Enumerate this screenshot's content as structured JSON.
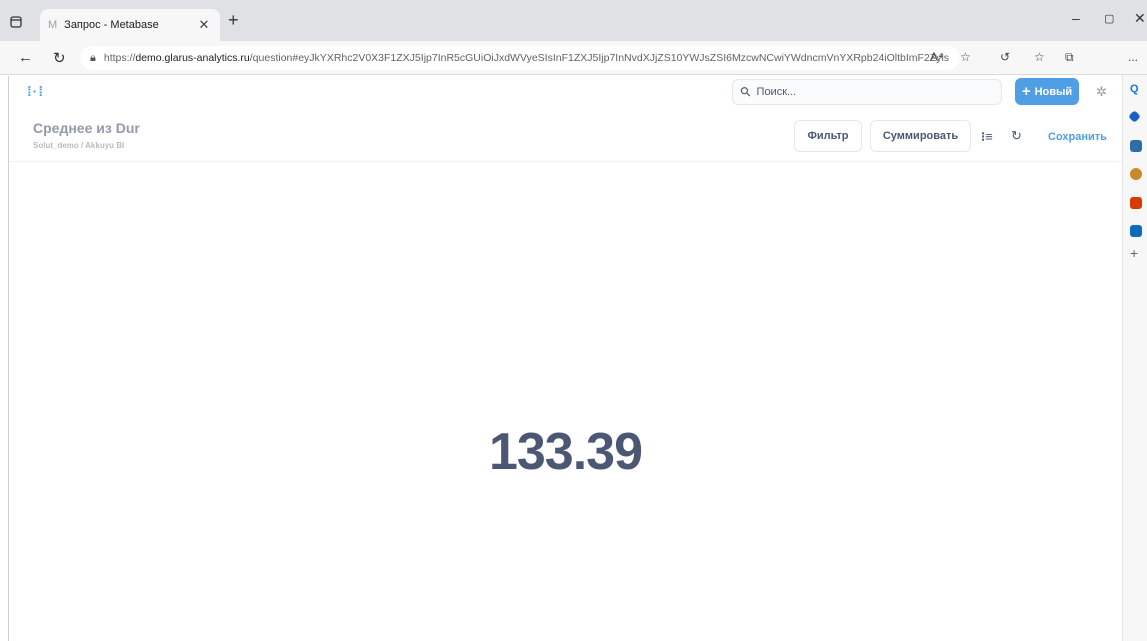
{
  "browser": {
    "tab_title": "Запрос - Metabase",
    "tab_favicon": "M",
    "new_tab_label": "+",
    "url_prefix": "https://",
    "url_host": "demo.glarus-analytics.ru",
    "url_path": "/question#eyJkYXRhc2V0X3F1ZXJ5Ijp7InR5cGUiOiJxdWVyeSIsInF1ZXJ5Ijp7InNvdXJjZS10YWJsZSI6MzcwNCwiYWdncmVnYXRpb24iOltbImF2Zyls...",
    "reader_icon": "A⁴",
    "more_label": "..."
  },
  "nav": {
    "logo": "⁞·⁞",
    "search_placeholder": "Поиск...",
    "new_button_label": "Новый",
    "new_button_icon": "+"
  },
  "question": {
    "title": "Среднее из Dur",
    "breadcrumb": "Solut_demo  /  Akkuyu BI",
    "filter_label": "Фильтр",
    "summarize_label": "Суммировать",
    "save_label": "Сохранить"
  },
  "result": {
    "value": "133.39"
  },
  "colors": {
    "brand": "#509ee3",
    "text_dark": "#4c5773",
    "text_muted": "#949aab"
  }
}
